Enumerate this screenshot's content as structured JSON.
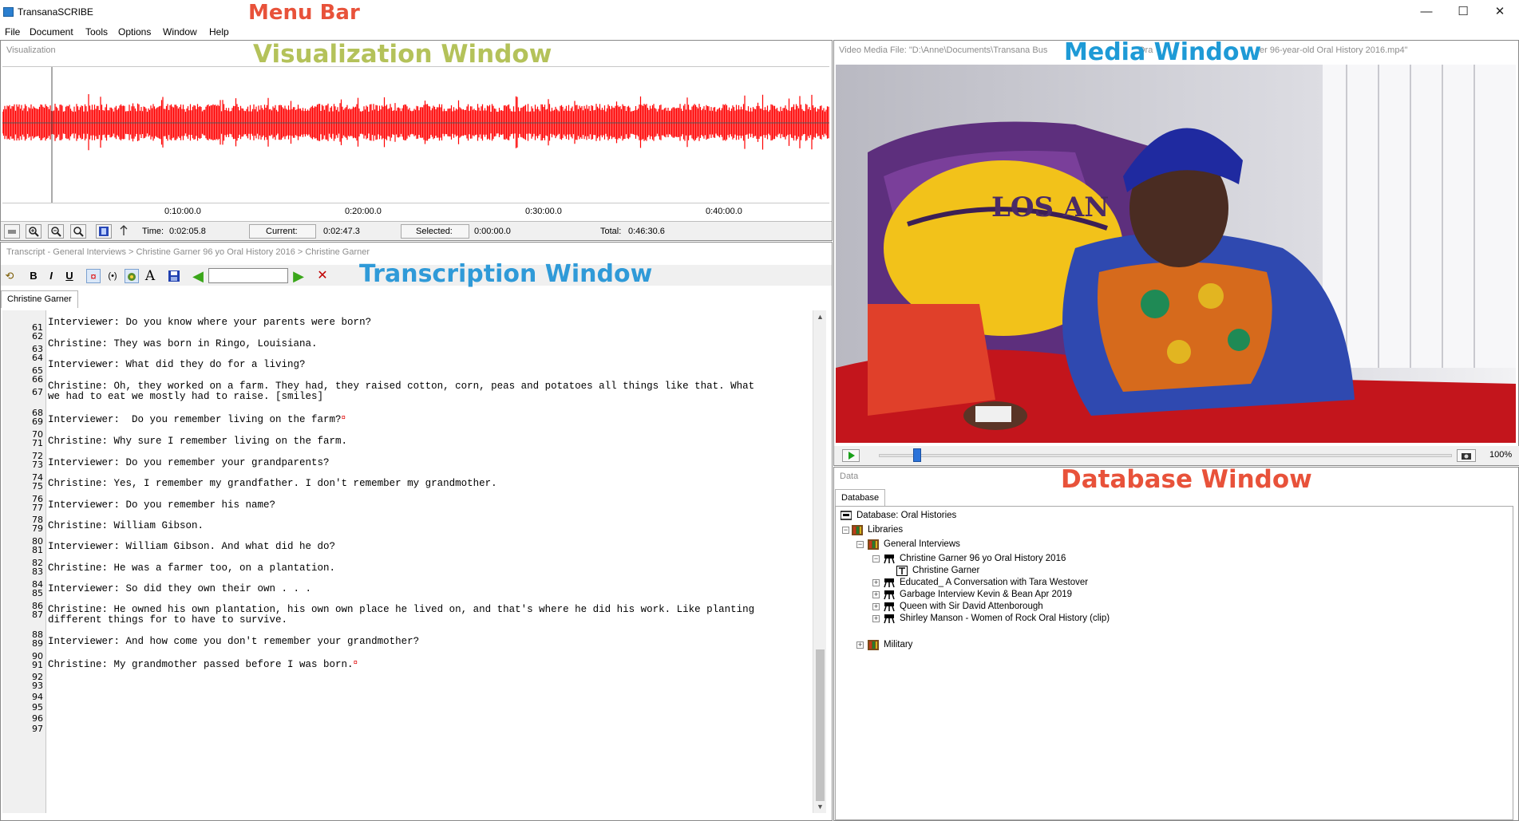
{
  "app": {
    "title": "TransanaSCRIBE",
    "window_controls": {
      "minimize": "—",
      "maximize": "☐",
      "close": "✕"
    }
  },
  "annotations": {
    "menu_bar": "Menu Bar",
    "visualization_window": "Visualization Window",
    "media_window": "Media Window",
    "transcription_window": "Transcription Window",
    "database_window": "Database Window"
  },
  "menu": [
    "File",
    "Document",
    "Tools",
    "Options",
    "Window",
    "Help"
  ],
  "visualization": {
    "caption": "Visualization",
    "time_axis": [
      "0:10:00.0",
      "0:20:00.0",
      "0:30:00.0",
      "0:40:00.0"
    ],
    "waveform_color": "#ff0000",
    "toolbar": {
      "time_label": "Time:",
      "time_value": "0:02:05.8",
      "current_label": "Current:",
      "current_value": "0:02:47.3",
      "selected_label": "Selected:",
      "selected_value": "0:00:00.0",
      "total_label": "Total:",
      "total_value": "0:46:30.6"
    }
  },
  "transcript": {
    "breadcrumb": "Transcript - General Interviews > Christine Garner 96 yo Oral History 2016 > Christine Garner",
    "tab": "Christine Garner",
    "toolbar": {
      "bold": "B",
      "italic": "I",
      "underline": "U",
      "font": "A",
      "search_value": "",
      "delete": "✕"
    },
    "lines": [
      {
        "n": "61",
        "text": "Interviewer: Do you know where your parents were born?"
      },
      {
        "n": "62",
        "text": ""
      },
      {
        "n": "63",
        "text": "Christine: They was born in Ringo, Louisiana."
      },
      {
        "n": "64",
        "text": ""
      },
      {
        "n": "65",
        "text": "Interviewer: What did they do for a living?"
      },
      {
        "n": "66",
        "text": ""
      },
      {
        "n": "67",
        "text": "Christine: Oh, they worked on a farm. They had, they raised cotton, corn, peas and potatoes all things like that. What"
      },
      {
        "n": "",
        "text": "we had to eat we mostly had to raise. [smiles]"
      },
      {
        "n": "68",
        "text": ""
      },
      {
        "n": "69",
        "text": "Interviewer:  Do you remember living on the farm?",
        "mark": "¤"
      },
      {
        "n": "70",
        "text": ""
      },
      {
        "n": "71",
        "text": "Christine: Why sure I remember living on the farm."
      },
      {
        "n": "72",
        "text": ""
      },
      {
        "n": "73",
        "text": "Interviewer: Do you remember your grandparents?"
      },
      {
        "n": "74",
        "text": ""
      },
      {
        "n": "75",
        "text": "Christine: Yes, I remember my grandfather. I don't remember my grandmother."
      },
      {
        "n": "76",
        "text": ""
      },
      {
        "n": "77",
        "text": "Interviewer: Do you remember his name?"
      },
      {
        "n": "78",
        "text": ""
      },
      {
        "n": "79",
        "text": "Christine: William Gibson."
      },
      {
        "n": "80",
        "text": ""
      },
      {
        "n": "81",
        "text": "Interviewer: William Gibson. And what did he do?"
      },
      {
        "n": "82",
        "text": ""
      },
      {
        "n": "83",
        "text": "Christine: He was a farmer too, on a plantation."
      },
      {
        "n": "84",
        "text": ""
      },
      {
        "n": "85",
        "text": "Interviewer: So did they own their own . . ."
      },
      {
        "n": "86",
        "text": ""
      },
      {
        "n": "87",
        "text": "Christine: He owned his own plantation, his own own place he lived on, and that's where he did his work. Like planting"
      },
      {
        "n": "",
        "text": "different things for to have to survive."
      },
      {
        "n": "88",
        "text": ""
      },
      {
        "n": "89",
        "text": "Interviewer: And how come you don't remember your grandmother?"
      },
      {
        "n": "90",
        "text": ""
      },
      {
        "n": "91",
        "text": "Christine: My grandmother passed before I was born.",
        "mark": "¤"
      },
      {
        "n": "92",
        "text": ""
      },
      {
        "n": "93",
        "text": ""
      },
      {
        "n": "94",
        "text": ""
      },
      {
        "n": "95",
        "text": ""
      },
      {
        "n": "96",
        "text": ""
      },
      {
        "n": "97",
        "text": ""
      }
    ]
  },
  "media": {
    "caption_left": "Video Media File: \"D:\\Anne\\Documents\\Transana Bus",
    "caption_mid": "Ora",
    "caption_right": "er 96-year-old Oral History 2016.mp4\"",
    "video_text": "LOS AN",
    "zoom": "100%",
    "play_position_fraction": 0.06
  },
  "database": {
    "caption": "Data",
    "tab": "Database",
    "root": "Database: Oral Histories",
    "libraries_label": "Libraries",
    "library": "General Interviews",
    "episodes": [
      {
        "label": "Christine Garner 96 yo Oral History 2016",
        "expanded": true
      },
      {
        "label": "Educated_ A Conversation with Tara Westover",
        "expanded": false
      },
      {
        "label": "Garbage Interview Kevin & Bean Apr 2019",
        "expanded": false
      },
      {
        "label": "Queen with Sir David Attenborough",
        "expanded": false
      },
      {
        "label": "Shirley Manson - Women of Rock Oral History (clip)",
        "expanded": false
      }
    ],
    "transcript_item": "Christine Garner",
    "other_library": "Military"
  }
}
